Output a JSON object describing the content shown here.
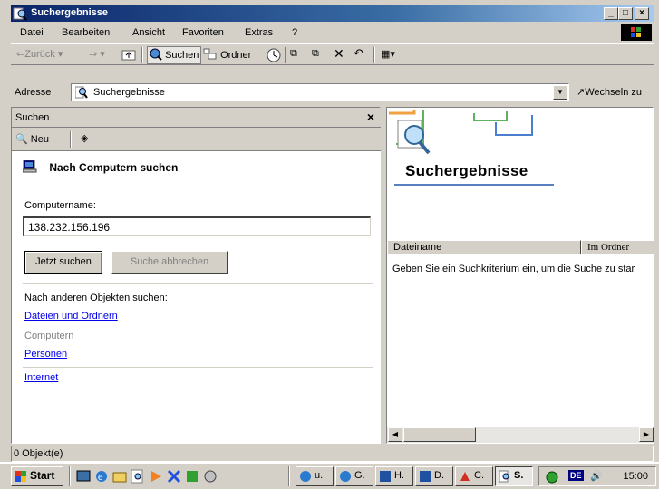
{
  "window": {
    "title": "Suchergebnisse"
  },
  "menu": {
    "items": [
      "Datei",
      "Bearbeiten",
      "Ansicht",
      "Favoriten",
      "Extras",
      "?"
    ]
  },
  "toolbar": {
    "back_label": "Zurück",
    "search_label": "Suchen",
    "folders_label": "Ordner"
  },
  "address": {
    "label": "Adresse",
    "value": "Suchergebnisse",
    "go_label": "Wechseln zu"
  },
  "search_pane": {
    "title": "Suchen",
    "new_label": "Neu",
    "heading": "Nach Computern suchen",
    "name_label": "Computername:",
    "name_value": "138.232.156.196",
    "search_now_label": "Jetzt suchen",
    "cancel_label": "Suche abbrechen",
    "other_label": "Nach anderen Objekten suchen:",
    "links": [
      "Dateien und Ordnern",
      "Computern",
      "Personen"
    ],
    "internet_label": "Internet"
  },
  "results": {
    "title": "Suchergebnisse",
    "columns": [
      "Dateiname",
      "Im Ordner"
    ],
    "message": "Geben Sie ein Suchkriterium ein, um die Suche zu star"
  },
  "status": {
    "text": "0 Objekt(e)"
  },
  "taskbar": {
    "start_label": "Start",
    "tasks": [
      "u.",
      "G.",
      "H.",
      "D.",
      "C.",
      "S."
    ],
    "lang": "DE",
    "clock": "15:00"
  },
  "colors": {
    "title_active": "#0a246a",
    "link": "#0000ee",
    "face": "#d4d0c8"
  }
}
